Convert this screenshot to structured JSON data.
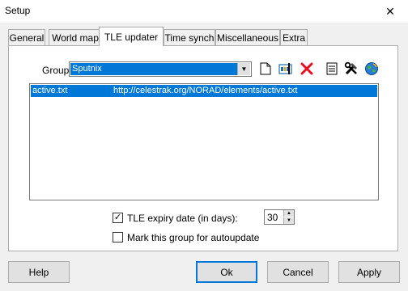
{
  "window": {
    "title": "Setup",
    "close_glyph": "✕"
  },
  "tabs": [
    {
      "label": "General"
    },
    {
      "label": "World map"
    },
    {
      "label": "TLE updater",
      "active": true
    },
    {
      "label": "Time synch"
    },
    {
      "label": "Miscellaneous"
    },
    {
      "label": "Extra"
    }
  ],
  "group": {
    "label": "Group",
    "selected": "Sputnix"
  },
  "toolbar": {
    "icons": [
      "new-file-icon",
      "rename-icon",
      "delete-icon",
      "notes-icon",
      "tools-icon",
      "update-globe-icon"
    ]
  },
  "list": {
    "rows": [
      {
        "name": "active.txt",
        "url": "http://celestrak.org/NORAD/elements/active.txt",
        "selected": true
      }
    ]
  },
  "expiry": {
    "label": "TLE expiry date (in days):",
    "checked": true,
    "value": "30"
  },
  "autoupdate": {
    "label": "Mark this group for autoupdate",
    "checked": false
  },
  "buttons": {
    "help": "Help",
    "ok": "Ok",
    "cancel": "Cancel",
    "apply": "Apply"
  },
  "colors": {
    "selection": "#0078d7",
    "delete_icon": "#e81123"
  }
}
